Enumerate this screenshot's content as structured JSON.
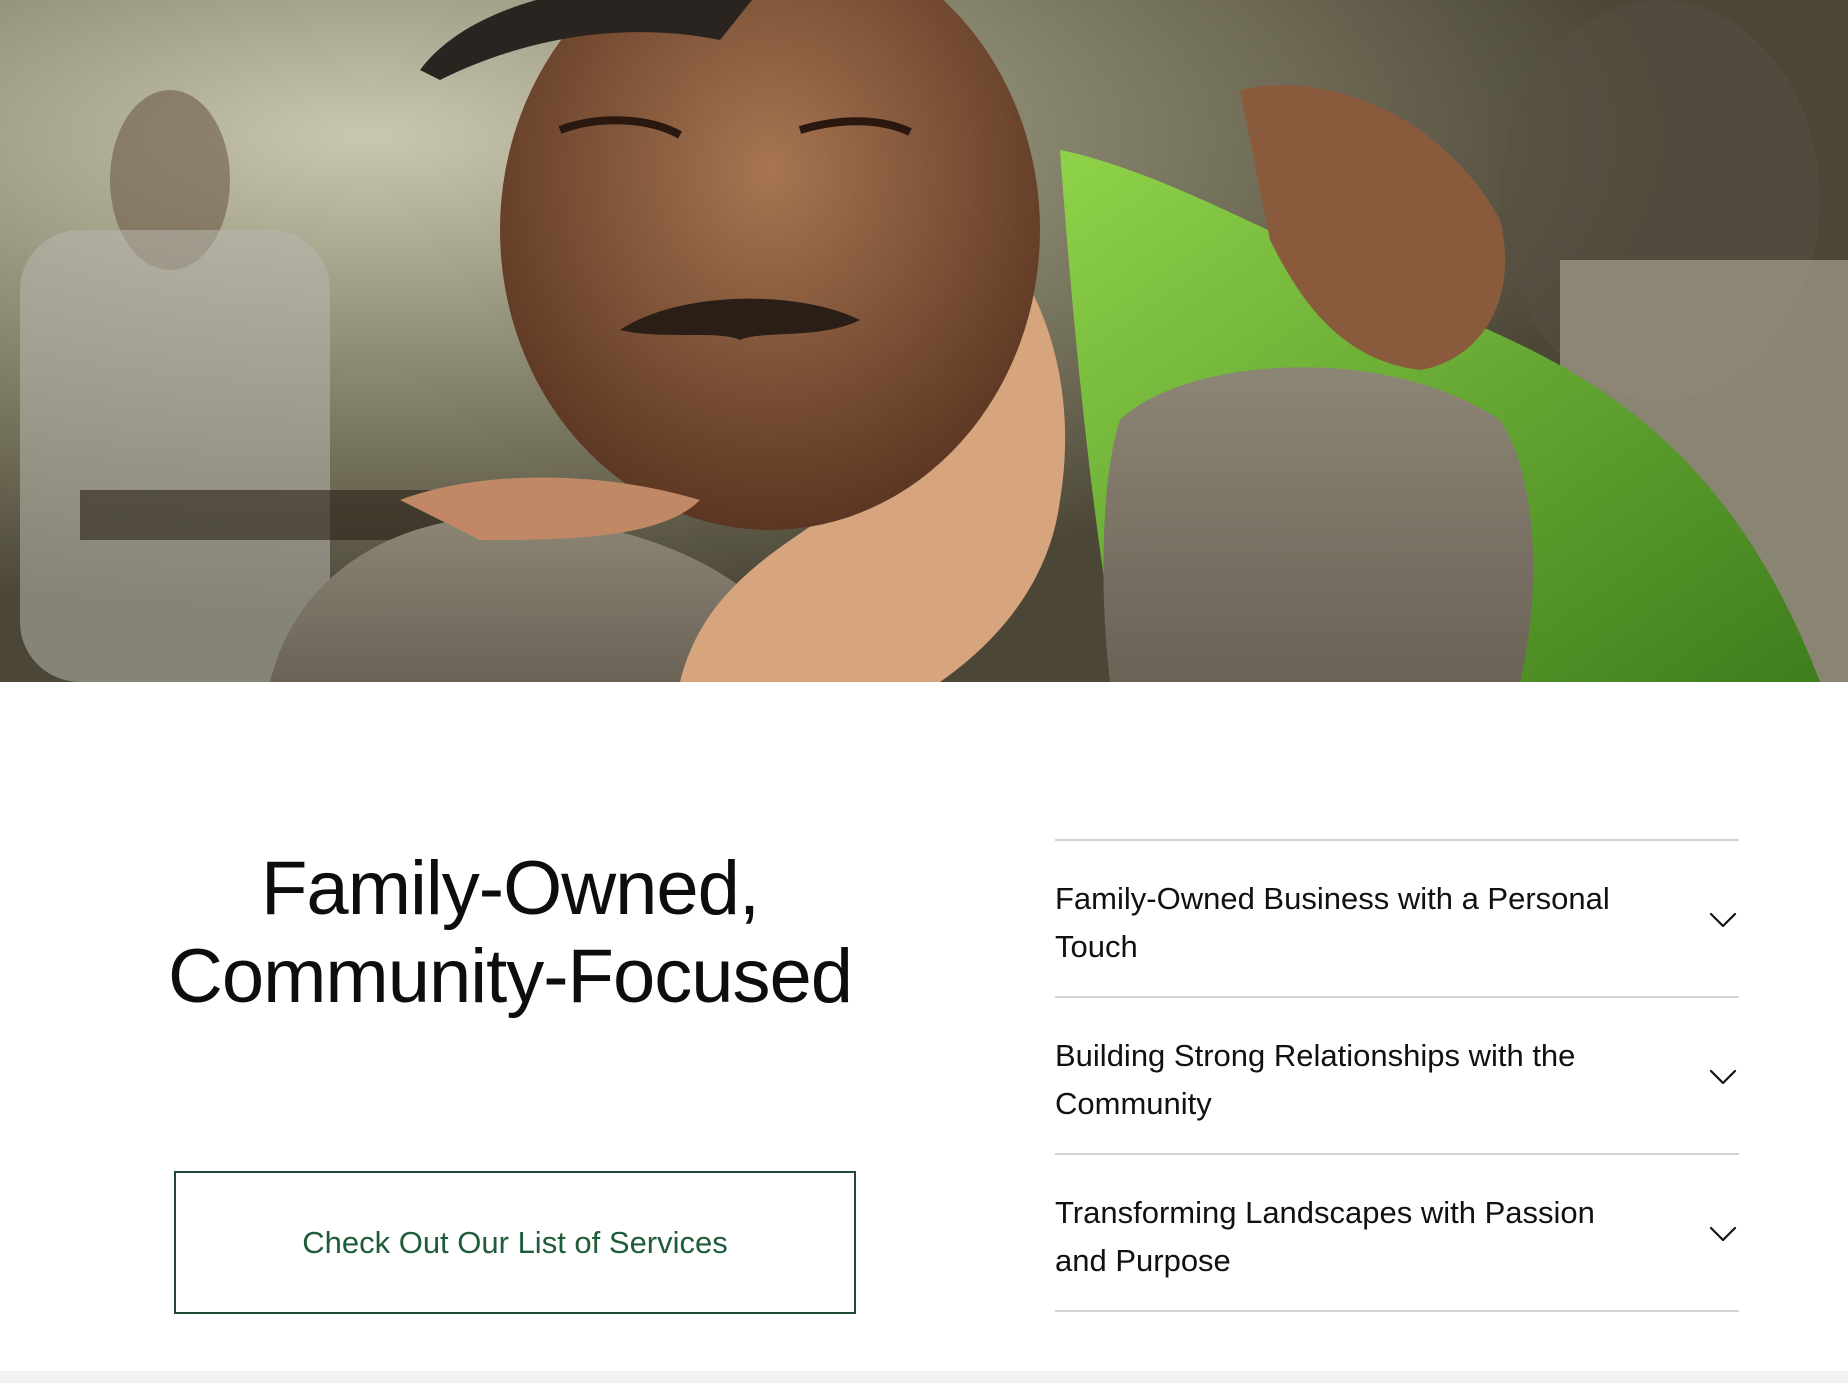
{
  "hero": {
    "image_alt": "Elderly man with a mustache hugging a young child wearing a green shirt"
  },
  "main": {
    "headline_line1": "Family-Owned,",
    "headline_line2": "Community-Focused",
    "cta_label": "Check Out Our List of Services"
  },
  "accordion": {
    "items": [
      {
        "title": "Family-Owned Business with a Personal Touch"
      },
      {
        "title": "Building Strong Relationships with the Community"
      },
      {
        "title": "Transforming Landscapes with Passion and Purpose"
      }
    ]
  },
  "colors": {
    "accent": "#1f5c3a",
    "border": "#1f4a33",
    "divider": "#d3d3d3",
    "text": "#0d0d0d"
  },
  "icons": {
    "accordion_toggle": "chevron-down-icon"
  }
}
